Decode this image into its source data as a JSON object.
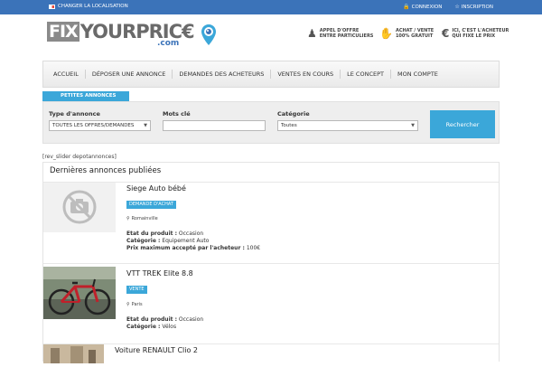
{
  "topbar": {
    "change_location": "CHANGER LA LOCALISATION",
    "login": "CONNEXION",
    "signup": "INSCRIPTION",
    "lock_icon": "lock-icon",
    "star_icon": "star-icon"
  },
  "brand": {
    "logo_fix": "FIX",
    "logo_rest": "YOURPRIC€",
    "logo_com": ".com",
    "accent": "#3b73b9",
    "highlight": "#3ba7d9"
  },
  "features": [
    {
      "line1": "APPEL D'OFFRE",
      "line2": "ENTRE PARTICULIERS",
      "icon": "people-icon"
    },
    {
      "line1": "ACHAT / VENTE",
      "line2": "100% GRATUIT",
      "icon": "thumbs-up-icon"
    },
    {
      "line1": "ICI, C'EST L'ACHETEUR",
      "line2": "QUI FIXE LE PRIX",
      "icon": "euro-icon"
    }
  ],
  "nav": [
    "ACCUEIL",
    "DÉPOSER UNE ANNONCE",
    "DEMANDES DES ACHETEURS",
    "VENTES EN COURS",
    "LE CONCEPT",
    "MON COMPTE"
  ],
  "search": {
    "tab": "PETITES ANNONCES",
    "type_label": "Type d'annonce",
    "type_value": "TOUTES LES OFFRES/DEMANDES",
    "keywords_label": "Mots clé",
    "keywords_value": "",
    "category_label": "Catégorie",
    "category_value": "Toutes",
    "button": "Rechercher"
  },
  "shortcode": "[rev_slider depotannonces]",
  "listing": {
    "title": "Dernières annonces publiées",
    "labels": {
      "state": "Etat du produit :",
      "category": "Catégorie :",
      "max_price": "Prix maximum accepté par l'acheteur :"
    },
    "items": [
      {
        "title": "Siege Auto bébé",
        "badge": "DEMANDE D'ACHAT",
        "city": "Romainville",
        "state": "Occasion",
        "category": "Equipement Auto",
        "max_price": "100€",
        "thumb": "no-photo-icon"
      },
      {
        "title": "VTT TREK Elite 8.8",
        "badge": "VENTE",
        "city": "Paris",
        "state": "Occasion",
        "category": "Vélos",
        "thumb": "bicycle-photo"
      },
      {
        "title": "Voiture RENAULT Clio 2",
        "thumb": "car-photo"
      }
    ]
  }
}
